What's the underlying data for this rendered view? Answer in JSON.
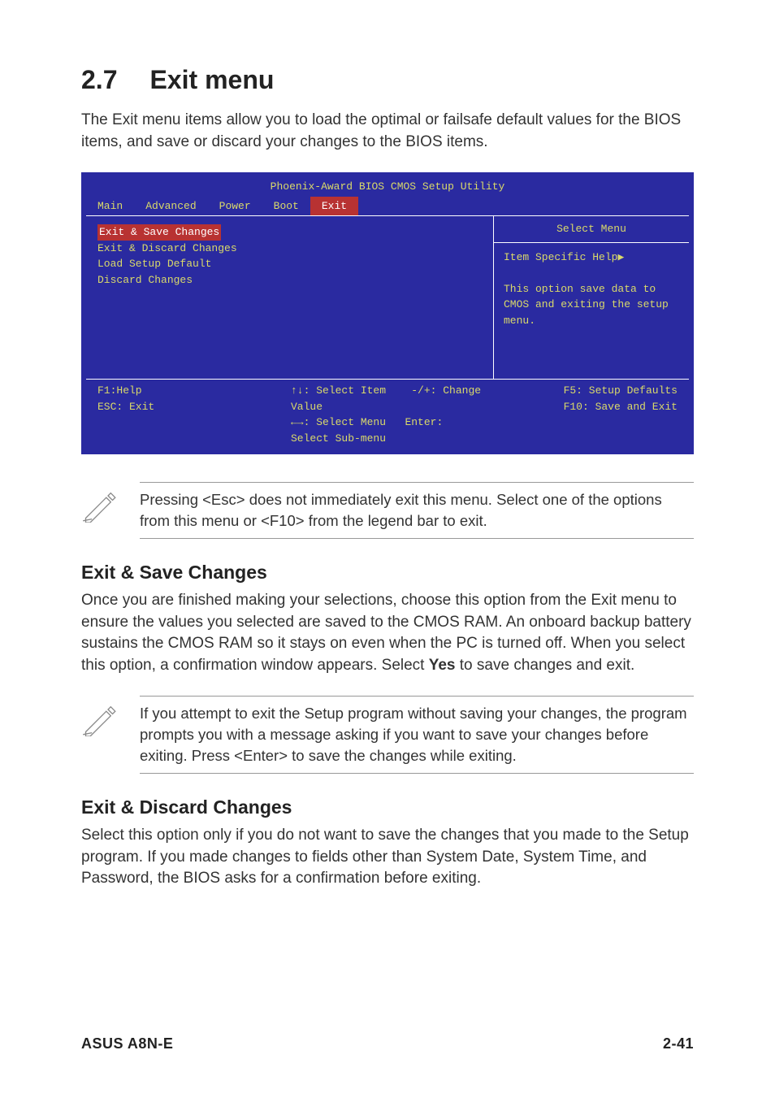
{
  "heading": {
    "num": "2.7",
    "title": "Exit menu"
  },
  "intro": "The Exit menu items allow you to load the optimal or failsafe default values for the BIOS items, and save or discard your changes to the BIOS items.",
  "bios": {
    "title": "Phoenix-Award BIOS CMOS Setup Utility",
    "tabs": {
      "t0": "Main",
      "t1": "Advanced",
      "t2": "Power",
      "t3": "Boot",
      "t4": "Exit"
    },
    "left": {
      "i0": "Exit & Save Changes",
      "i1": "Exit & Discard Changes",
      "i2": "Load Setup Default",
      "i3": "Discard Changes"
    },
    "rightTitle": "Select Menu",
    "rightHelpLabel": "Item Specific Help",
    "rightHelpText": "This option save data to CMOS and exiting the setup menu.",
    "foot": {
      "l1": "F1:Help",
      "l2": "ESC: Exit",
      "m1a": ": Select Item",
      "m1b": "-/+:  Change Value",
      "m2a": ": Select Menu",
      "m2b": "Enter: Select Sub-menu",
      "r1": "F5: Setup Defaults",
      "r2": "F10: Save and Exit"
    }
  },
  "note1": "Pressing <Esc> does not immediately exit this menu. Select one of the options from this menu or <F10> from the legend bar to exit.",
  "sec1": {
    "title": "Exit & Save Changes",
    "body1": "Once you are finished making your selections, choose this option from the Exit menu to ensure the values you selected are saved to the CMOS RAM. An onboard backup battery sustains the CMOS RAM so it stays on even when the PC is turned off. When you select this option, a confirmation window appears. Select ",
    "yes": "Yes",
    "body2": " to save changes and exit."
  },
  "note2": " If you attempt to exit the Setup program without saving your changes, the program prompts you with a message asking if you want to save your changes before exiting. Press <Enter>  to save the  changes while exiting.",
  "sec2": {
    "title": "Exit & Discard Changes",
    "body": "Select this option only if you do not want to save the changes that you made to the Setup program. If you made changes to fields other than System Date, System Time, and Password, the BIOS asks for a confirmation before exiting."
  },
  "footer": {
    "left": "ASUS A8N-E",
    "right": "2-41"
  }
}
